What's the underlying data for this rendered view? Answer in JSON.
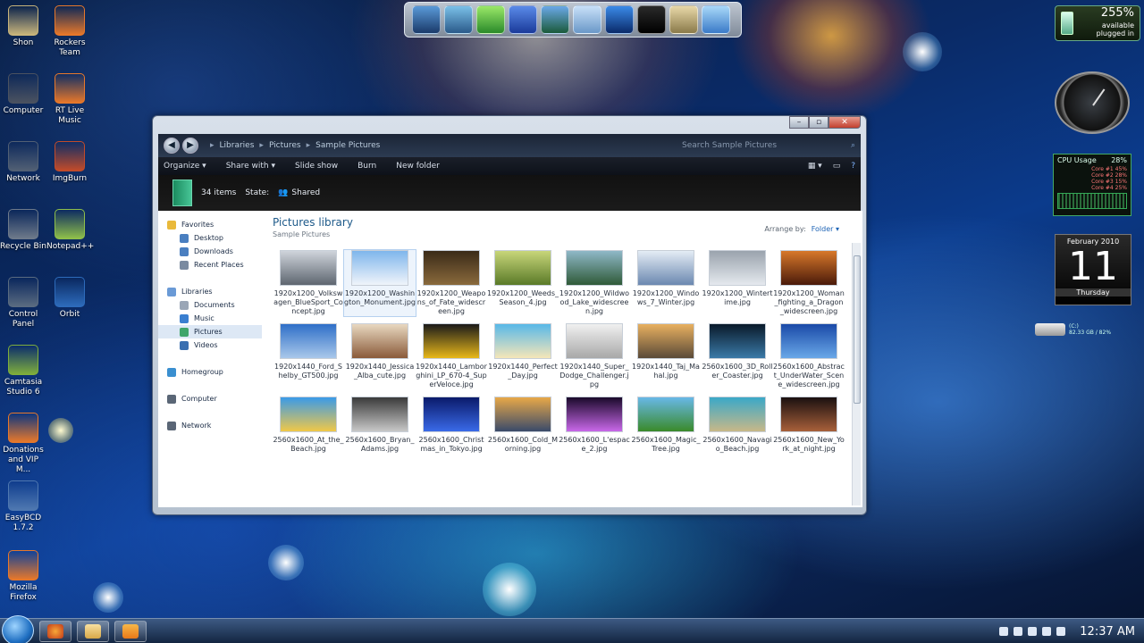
{
  "desktop": {
    "icons": [
      {
        "label": "Shon",
        "color": "#c9b57b"
      },
      {
        "label": "Rockers Team",
        "color": "#e8782a"
      },
      {
        "label": "Computer",
        "color": "#4b5260"
      },
      {
        "label": "RT Live Music",
        "color": "#e8782a"
      },
      {
        "label": "Network",
        "color": "#526074"
      },
      {
        "label": "ImgBurn",
        "color": "#c24b2a"
      },
      {
        "label": "Recycle Bin",
        "color": "#6e7a8a"
      },
      {
        "label": "Notepad++",
        "color": "#8fbf4a"
      },
      {
        "label": "Control Panel",
        "color": "#5a6b80"
      },
      {
        "label": "Orbit",
        "color": "#2d6bbb"
      },
      {
        "label": "Camtasia Studio 6",
        "color": "#7fae3c"
      },
      {
        "label": "Donations and VIP M...",
        "color": "#e8782a"
      },
      {
        "label": "EasyBCD 1.7.2",
        "color": "#4f78b0"
      },
      {
        "label": "Mozilla Firefox",
        "color": "#e8782a"
      }
    ]
  },
  "window": {
    "breadcrumbs": [
      "Libraries",
      "Pictures",
      "Sample Pictures"
    ],
    "search_placeholder": "Search Sample Pictures",
    "toolbar": [
      "Organize ▾",
      "Share with ▾",
      "Slide show",
      "Burn",
      "New folder"
    ],
    "info": {
      "items": "34 items",
      "state_label": "State:",
      "state_value": "Shared"
    },
    "nav": [
      {
        "label": "Favorites",
        "indent": 0,
        "icon_color": "#e9b93b"
      },
      {
        "label": "Desktop",
        "indent": 1,
        "icon_color": "#4a7fc0"
      },
      {
        "label": "Downloads",
        "indent": 1,
        "icon_color": "#4a7fc0"
      },
      {
        "label": "Recent Places",
        "indent": 1,
        "icon_color": "#7a8aa0"
      },
      {
        "label": "",
        "indent": 0,
        "icon_color": ""
      },
      {
        "label": "Libraries",
        "indent": 0,
        "icon_color": "#6a9ad6"
      },
      {
        "label": "Documents",
        "indent": 1,
        "icon_color": "#9aa6b6"
      },
      {
        "label": "Music",
        "indent": 1,
        "icon_color": "#3a7fd0"
      },
      {
        "label": "Pictures",
        "indent": 1,
        "icon_color": "#3fa56a",
        "selected": true
      },
      {
        "label": "Videos",
        "indent": 1,
        "icon_color": "#3a6fb0"
      },
      {
        "label": "",
        "indent": 0,
        "icon_color": ""
      },
      {
        "label": "Homegroup",
        "indent": 0,
        "icon_color": "#3a8fd0"
      },
      {
        "label": "",
        "indent": 0,
        "icon_color": ""
      },
      {
        "label": "Computer",
        "indent": 0,
        "icon_color": "#5a6676"
      },
      {
        "label": "",
        "indent": 0,
        "icon_color": ""
      },
      {
        "label": "Network",
        "indent": 0,
        "icon_color": "#5a6676"
      }
    ],
    "library_title": "Pictures library",
    "library_subtitle": "Sample Pictures",
    "arrange_label": "Arrange by:",
    "arrange_value": "Folder ▾",
    "files": [
      {
        "name": "1920x1200_Volkswagen_BlueSport_Concept.jpg",
        "c1": "#cfd4db",
        "c2": "#5e6670"
      },
      {
        "name": "1920x1200_Washington_Monument.jpg",
        "c1": "#7fb6ec",
        "c2": "#f0f4fa",
        "hl": true
      },
      {
        "name": "1920x1200_Weapons_of_Fate_widescreen.jpg",
        "c1": "#3a2a18",
        "c2": "#8a6a3c"
      },
      {
        "name": "1920x1200_Weeds_Season_4.jpg",
        "c1": "#c8d67a",
        "c2": "#5a7a28"
      },
      {
        "name": "1920x1200_Wildwood_Lake_widescreen.jpg",
        "c1": "#8fb8c8",
        "c2": "#2f5a38"
      },
      {
        "name": "1920x1200_Windows_7_Winter.jpg",
        "c1": "#e4ecf5",
        "c2": "#6b88b0"
      },
      {
        "name": "1920x1200_Wintertime.jpg",
        "c1": "#9aa3ad",
        "c2": "#e5e9ee"
      },
      {
        "name": "1920x1200_Woman_fighting_a_Dragon_widescreen.jpg",
        "c1": "#d8782a",
        "c2": "#4a1a0a"
      },
      {
        "name": "1920x1440_Ford_Shelby_GT500.jpg",
        "c1": "#2f6fc8",
        "c2": "#a9c8ea"
      },
      {
        "name": "1920x1440_Jessica_Alba_cute.jpg",
        "c1": "#e8d8c0",
        "c2": "#8a5a3a"
      },
      {
        "name": "1920x1440_Lamborghini_LP_670-4_SuperVeloce.jpg",
        "c1": "#1a1a1a",
        "c2": "#e8b81a"
      },
      {
        "name": "1920x1440_Perfect_Day.jpg",
        "c1": "#58b8e8",
        "c2": "#f5e6b8"
      },
      {
        "name": "1920x1440_Super_Dodge_Challenger.jpg",
        "c1": "#f0f0f0",
        "c2": "#a8a8a8"
      },
      {
        "name": "1920x1440_Taj_Mahal.jpg",
        "c1": "#e8b060",
        "c2": "#5a4a38"
      },
      {
        "name": "2560x1600_3D_Roller_Coaster.jpg",
        "c1": "#0a1a2a",
        "c2": "#3a7aa8"
      },
      {
        "name": "2560x1600_Abstract_UnderWater_Scene_widescreen.jpg",
        "c1": "#1a4aa8",
        "c2": "#6aa8e8"
      },
      {
        "name": "2560x1600_At_the_Beach.jpg",
        "c1": "#3a9ae8",
        "c2": "#f0c848"
      },
      {
        "name": "2560x1600_Bryan_Adams.jpg",
        "c1": "#3a3a3a",
        "c2": "#c8c8c8"
      },
      {
        "name": "2560x1600_Christmas_in_Tokyo.jpg",
        "c1": "#0a1a6a",
        "c2": "#3a6ae8"
      },
      {
        "name": "2560x1600_Cold_Morning.jpg",
        "c1": "#e8a848",
        "c2": "#3a4a6a"
      },
      {
        "name": "2560x1600_L'espace_2.jpg",
        "c1": "#1a0a2a",
        "c2": "#c868e8"
      },
      {
        "name": "2560x1600_Magic_Tree.jpg",
        "c1": "#68b8e8",
        "c2": "#3a8a2a"
      },
      {
        "name": "2560x1600_Navagio_Beach.jpg",
        "c1": "#3aa8c8",
        "c2": "#c8b888"
      },
      {
        "name": "2560x1600_New_York_at_night.jpg",
        "c1": "#1a1010",
        "c2": "#a8603a"
      }
    ]
  },
  "gadgets": {
    "battery_pct": "255%",
    "battery_status": "available",
    "battery_status2": "plugged in",
    "cpu_title": "CPU Usage",
    "cpu_value": "28%",
    "cores": [
      "Core #1  45%",
      "Core #2  28%",
      "Core #3  15%",
      "Core #4  25%"
    ],
    "cal_month": "February 2010",
    "cal_day": "11",
    "cal_weekday": "Thursday",
    "drive_label": "(C:)",
    "drive_info": "82.33 GB / 82%"
  },
  "taskbar": {
    "time": "12:37 AM"
  }
}
